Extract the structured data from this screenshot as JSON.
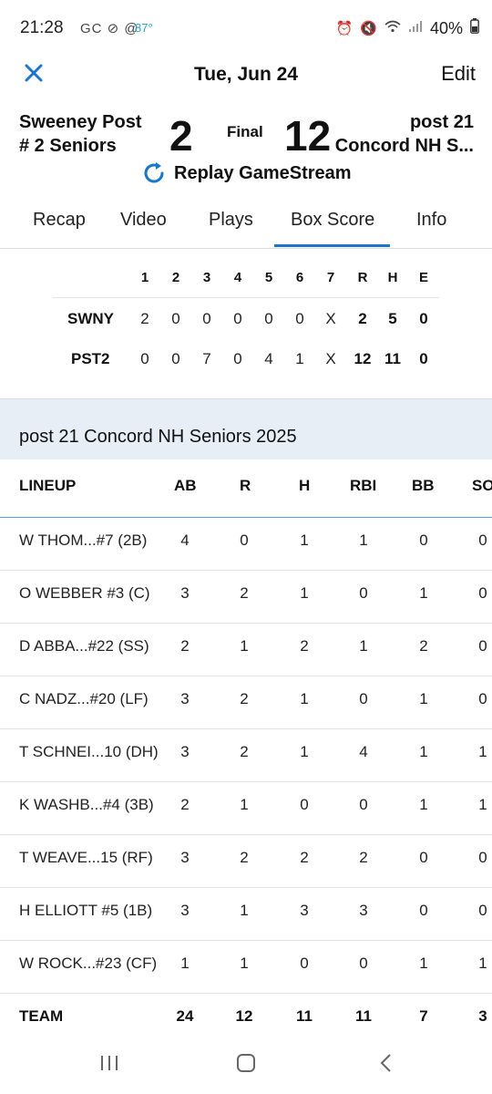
{
  "status_bar": {
    "time": "21:28",
    "left_icons": "GC ⊘ @",
    "temperature": "87°",
    "battery": "40%"
  },
  "header": {
    "date": "Tue, Jun 24",
    "edit_label": "Edit",
    "close_icon": "close-icon"
  },
  "game": {
    "home_team_line1": "Sweeney Post",
    "home_team_line2": "# 2 Seniors",
    "home_score": "2",
    "status": "Final",
    "away_score": "12",
    "away_team_line1": "post 21",
    "away_team_line2": "Concord NH S...",
    "replay_label": "Replay GameStream"
  },
  "tabs": [
    "Recap",
    "Video",
    "Plays",
    "Box Score",
    "Info"
  ],
  "active_tab": "Box Score",
  "linescore": {
    "headers": [
      "1",
      "2",
      "3",
      "4",
      "5",
      "6",
      "7",
      "R",
      "H",
      "E"
    ],
    "rows": [
      {
        "team": "SWNY",
        "innings": [
          "2",
          "0",
          "0",
          "0",
          "0",
          "0",
          "X"
        ],
        "r": "2",
        "h": "5",
        "e": "0"
      },
      {
        "team": "PST2",
        "innings": [
          "0",
          "0",
          "7",
          "0",
          "4",
          "1",
          "X"
        ],
        "r": "12",
        "h": "11",
        "e": "0"
      }
    ]
  },
  "boxscore": {
    "section_title": "post 21 Concord NH Seniors 2025",
    "columns": [
      "LINEUP",
      "AB",
      "R",
      "H",
      "RBI",
      "BB",
      "SO"
    ],
    "players": [
      {
        "name": "W THOM...#7 (2B)",
        "ab": "4",
        "r": "0",
        "h": "1",
        "rbi": "1",
        "bb": "0",
        "so": "0"
      },
      {
        "name": "O WEBBER #3 (C)",
        "ab": "3",
        "r": "2",
        "h": "1",
        "rbi": "0",
        "bb": "1",
        "so": "0"
      },
      {
        "name": "D ABBA...#22 (SS)",
        "ab": "2",
        "r": "1",
        "h": "2",
        "rbi": "1",
        "bb": "2",
        "so": "0"
      },
      {
        "name": "C NADZ...#20 (LF)",
        "ab": "3",
        "r": "2",
        "h": "1",
        "rbi": "0",
        "bb": "1",
        "so": "0"
      },
      {
        "name": "T SCHNEI...10 (DH)",
        "ab": "3",
        "r": "2",
        "h": "1",
        "rbi": "4",
        "bb": "1",
        "so": "1"
      },
      {
        "name": "K WASHB...#4 (3B)",
        "ab": "2",
        "r": "1",
        "h": "0",
        "rbi": "0",
        "bb": "1",
        "so": "1"
      },
      {
        "name": "T WEAVE...15 (RF)",
        "ab": "3",
        "r": "2",
        "h": "2",
        "rbi": "2",
        "bb": "0",
        "so": "0"
      },
      {
        "name": "H ELLIOTT #5 (1B)",
        "ab": "3",
        "r": "1",
        "h": "3",
        "rbi": "3",
        "bb": "0",
        "so": "0"
      },
      {
        "name": "W ROCK...#23 (CF)",
        "ab": "1",
        "r": "1",
        "h": "0",
        "rbi": "0",
        "bb": "1",
        "so": "1"
      }
    ],
    "team_total": {
      "name": "TEAM",
      "ab": "24",
      "r": "12",
      "h": "11",
      "rbi": "11",
      "bb": "7",
      "so": "3"
    }
  },
  "nav": {
    "recents_icon": "recents-icon",
    "home_icon": "home-icon",
    "back_icon": "back-icon"
  }
}
